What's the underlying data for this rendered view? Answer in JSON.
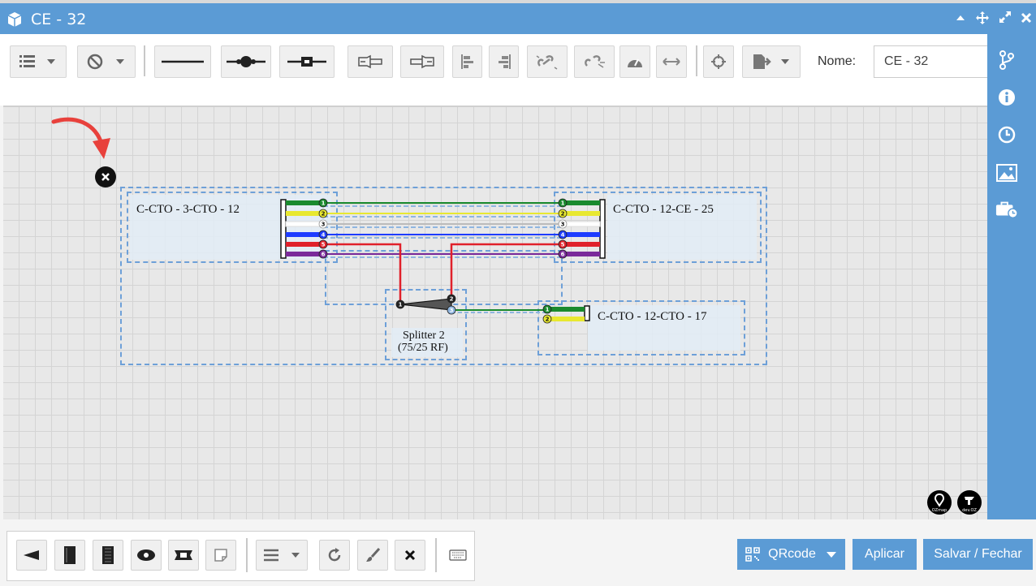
{
  "window": {
    "title": "CE - 32"
  },
  "toolbar": {
    "nome_label": "Nome:",
    "nome_value": "CE - 32"
  },
  "diagram": {
    "box_left_label": "C-CTO - 3-CTO - 12",
    "box_right_label": "C-CTO - 12-CE - 25",
    "box_small_label": "C-CTO - 12-CTO - 17",
    "splitter_name": "Splitter 2",
    "splitter_ratio": "(75/25 RF)",
    "fiber_colors": [
      "#1a8a2e",
      "#e8e830",
      "#ffffff",
      "#1e3cff",
      "#e0202a",
      "#7a2a9a"
    ],
    "fiber_numbers": [
      "1",
      "2",
      "3",
      "4",
      "5",
      "6"
    ],
    "small_fiber_numbers": [
      "1",
      "2"
    ],
    "splitter_ports": [
      "1",
      "2",
      "3"
    ]
  },
  "bottom": {
    "qrcode_label": "QRcode",
    "aplicar_label": "Aplicar",
    "salvar_label": "Salvar / Fechar"
  }
}
